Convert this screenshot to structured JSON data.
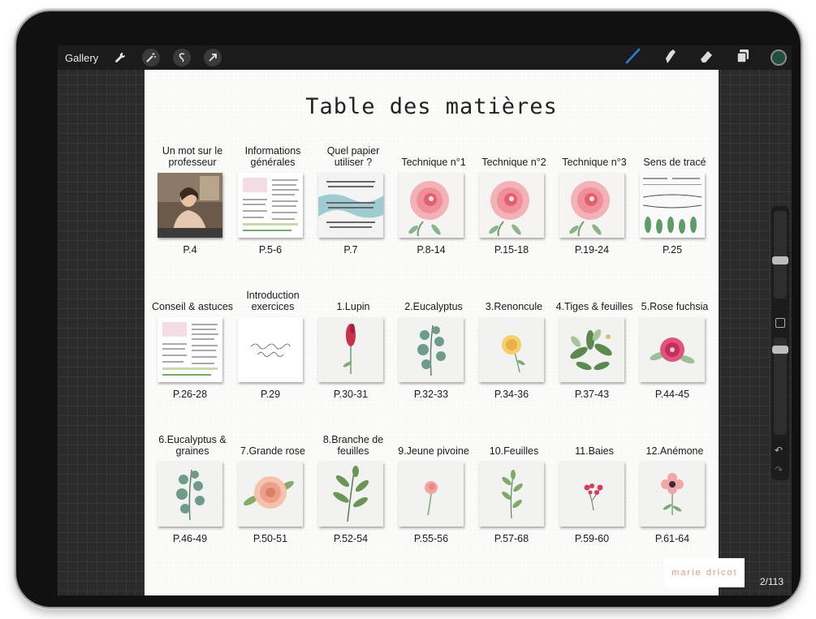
{
  "toolbar": {
    "gallery_label": "Gallery",
    "left_icons": [
      "wrench-icon",
      "magic-wand-icon",
      "selection-icon",
      "transform-arrow-icon"
    ],
    "right_icons": [
      "brush-icon",
      "smudge-icon",
      "eraser-icon",
      "layers-icon"
    ],
    "brush_color": "#2f7fd8",
    "current_color": "#1f4d3e"
  },
  "document": {
    "title": "Table des matières",
    "signature": "marie dricot",
    "rows": [
      [
        {
          "label": "Un mot sur le professeur",
          "page": "P.4",
          "thumb": "photo"
        },
        {
          "label": "Informations générales",
          "page": "P.5-6",
          "thumb": "doc"
        },
        {
          "label": "Quel papier utiliser ?",
          "page": "P.7",
          "thumb": "paper"
        },
        {
          "label": "Technique n°1",
          "page": "P.8-14",
          "thumb": "rose"
        },
        {
          "label": "Technique n°2",
          "page": "P.15-18",
          "thumb": "rose"
        },
        {
          "label": "Technique n°3",
          "page": "P.19-24",
          "thumb": "rose"
        },
        {
          "label": "Sens de tracé",
          "page": "P.25",
          "thumb": "strokes"
        }
      ],
      [
        {
          "label": "Conseil & astuces",
          "page": "P.26-28",
          "thumb": "doc"
        },
        {
          "label": "Introduction exercices",
          "page": "P.29",
          "thumb": "script"
        },
        {
          "label": "1.Lupin",
          "page": "P.30-31",
          "thumb": "lupin"
        },
        {
          "label": "2.Eucalyptus",
          "page": "P.32-33",
          "thumb": "eucalyptus"
        },
        {
          "label": "3.Renoncule",
          "page": "P.34-36",
          "thumb": "yellow"
        },
        {
          "label": "4.Tiges & feuilles",
          "page": "P.37-43",
          "thumb": "bouquet"
        },
        {
          "label": "5.Rose fuchsia",
          "page": "P.44-45",
          "thumb": "fuchsia"
        }
      ],
      [
        {
          "label": "6.Eucalyptus & graines",
          "page": "P.46-49",
          "thumb": "eucalyptus"
        },
        {
          "label": "7.Grande rose",
          "page": "P.50-51",
          "thumb": "bigrose"
        },
        {
          "label": "8.Branche de feuilles",
          "page": "P.52-54",
          "thumb": "branch"
        },
        {
          "label": "9.Jeune pivoine",
          "page": "P.55-56",
          "thumb": "peony"
        },
        {
          "label": "10.Feuilles",
          "page": "P.57-68",
          "thumb": "leaves"
        },
        {
          "label": "11.Baies",
          "page": "P.59-60",
          "thumb": "berries"
        },
        {
          "label": "12.Anémone",
          "page": "P.61-64",
          "thumb": "anemone"
        }
      ]
    ]
  },
  "page_counter": "2/113"
}
